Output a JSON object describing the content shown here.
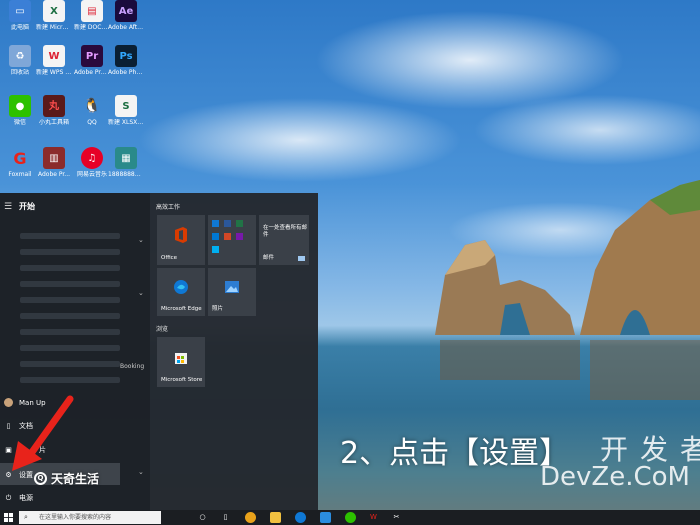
{
  "desktop": {
    "icons": [
      {
        "label": "此电脑"
      },
      {
        "label": "新建 Microsoft Excel 工作表"
      },
      {
        "label": "新建 DOCX 文档"
      },
      {
        "label": "Adobe After Effects 2022"
      },
      {
        "label": "回收站"
      },
      {
        "label": "新建 WPS 文字文档"
      },
      {
        "label": "Adobe Premiere"
      },
      {
        "label": "Adobe Photoshop"
      },
      {
        "label": "微信"
      },
      {
        "label": "小丸工具箱"
      },
      {
        "label": "QQ"
      },
      {
        "label": "新建 XLSX 工作表"
      },
      {
        "label": "Foxmail"
      },
      {
        "label": "Adobe Pr..."
      },
      {
        "label": "网易云音乐"
      },
      {
        "label": "18888888..."
      }
    ]
  },
  "start_menu": {
    "title": "开始",
    "list_partial_text": "Booking",
    "side": {
      "user": "Man Up",
      "documents": "文档",
      "pictures": "片",
      "settings": "设置",
      "power": "电源"
    },
    "groups": {
      "productivity": "高效工作",
      "browse": "浏览"
    },
    "tiles": {
      "office": "Office",
      "mail_heading": "在一处查看所有邮件",
      "mail": "邮件",
      "edge": "Microsoft Edge",
      "photos": "照片",
      "store": "Microsoft Store"
    }
  },
  "taskbar": {
    "search_placeholder": "在这里输入你要搜索的内容"
  },
  "overlay": {
    "brand": "天奇生活",
    "caption": "2、点击【设置】",
    "watermark_cn": "开发者",
    "watermark_en": "DevZe.CoM"
  },
  "colors": {
    "arrow": "#e8231b",
    "office_red": "#d83b01",
    "edge_blue": "#0f78d4",
    "store_bg": "#3a4048"
  }
}
